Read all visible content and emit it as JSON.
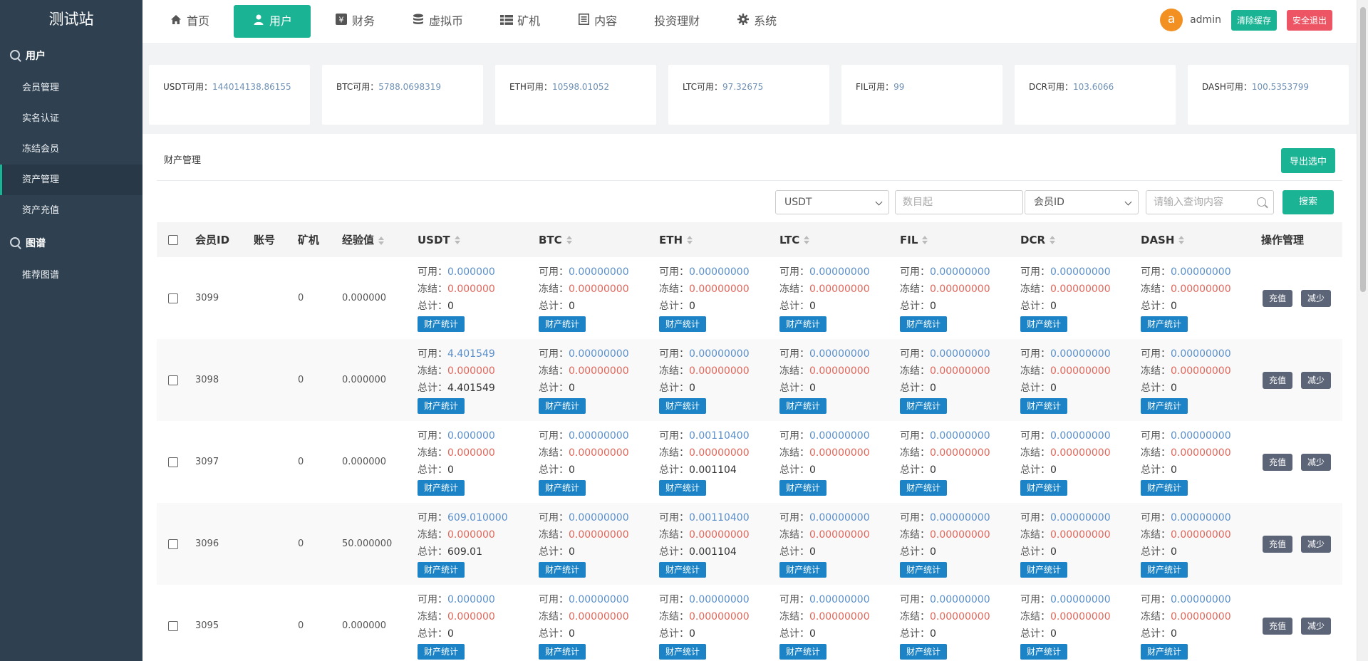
{
  "site": {
    "brand": "测试站"
  },
  "sidebar": {
    "groups": [
      {
        "label": "用户",
        "items": [
          "会员管理",
          "实名认证",
          "冻结会员",
          "资产管理",
          "资产充值"
        ]
      },
      {
        "label": "图谱",
        "items": [
          "推荐图谱"
        ]
      }
    ],
    "active_item": "资产管理"
  },
  "nav": {
    "items": [
      {
        "label": "首页",
        "icon": "home-icon"
      },
      {
        "label": "用户",
        "icon": "user-icon"
      },
      {
        "label": "财务",
        "icon": "yen-icon"
      },
      {
        "label": "虚拟币",
        "icon": "database-icon"
      },
      {
        "label": "矿机",
        "icon": "server-icon"
      },
      {
        "label": "内容",
        "icon": "document-icon"
      },
      {
        "label": "投资理财",
        "icon": ""
      },
      {
        "label": "系统",
        "icon": "gear-icon"
      }
    ],
    "active": "用户"
  },
  "user": {
    "avatar_letter": "a",
    "name": "admin",
    "clear_cache": "清除缓存",
    "logout": "安全退出"
  },
  "stats": [
    {
      "label": "USDT可用：",
      "value": "144014138.86155"
    },
    {
      "label": "BTC可用：",
      "value": "5788.0698319"
    },
    {
      "label": "ETH可用：",
      "value": "10598.01052"
    },
    {
      "label": "LTC可用：",
      "value": "97.32675"
    },
    {
      "label": "FIL可用：",
      "value": "99"
    },
    {
      "label": "DCR可用：",
      "value": "103.6066"
    },
    {
      "label": "DASH可用：",
      "value": "100.5353799"
    }
  ],
  "panel": {
    "title": "财产管理",
    "export_label": "导出选中",
    "filters": {
      "coin_select": "USDT",
      "amount_placeholder": "数目起",
      "field_select": "会员ID",
      "query_placeholder": "请输入查询内容",
      "search_label": "搜索"
    }
  },
  "table": {
    "headers": {
      "member_id": "会员ID",
      "account": "账号",
      "miner": "矿机",
      "exp": "经验值",
      "coins": [
        "USDT",
        "BTC",
        "ETH",
        "LTC",
        "FIL",
        "DCR",
        "DASH"
      ],
      "ops": "操作管理"
    },
    "labels": {
      "available": "可用：",
      "frozen": "冻结：",
      "total": "总计：",
      "stat_button": "财产统计",
      "recharge": "充值",
      "reduce": "减少"
    },
    "rows": [
      {
        "id": "3099",
        "account": "",
        "miner": "0",
        "exp": "0.000000",
        "coins": [
          {
            "avail": "0.000000",
            "frozen": "0.000000",
            "total": "0"
          },
          {
            "avail": "0.00000000",
            "frozen": "0.00000000",
            "total": "0"
          },
          {
            "avail": "0.00000000",
            "frozen": "0.00000000",
            "total": "0"
          },
          {
            "avail": "0.00000000",
            "frozen": "0.00000000",
            "total": "0"
          },
          {
            "avail": "0.00000000",
            "frozen": "0.00000000",
            "total": "0"
          },
          {
            "avail": "0.00000000",
            "frozen": "0.00000000",
            "total": "0"
          },
          {
            "avail": "0.00000000",
            "frozen": "0.00000000",
            "total": "0"
          }
        ]
      },
      {
        "id": "3098",
        "account": "",
        "miner": "0",
        "exp": "0.000000",
        "coins": [
          {
            "avail": "4.401549",
            "frozen": "0.000000",
            "total": "4.401549"
          },
          {
            "avail": "0.00000000",
            "frozen": "0.00000000",
            "total": "0"
          },
          {
            "avail": "0.00000000",
            "frozen": "0.00000000",
            "total": "0"
          },
          {
            "avail": "0.00000000",
            "frozen": "0.00000000",
            "total": "0"
          },
          {
            "avail": "0.00000000",
            "frozen": "0.00000000",
            "total": "0"
          },
          {
            "avail": "0.00000000",
            "frozen": "0.00000000",
            "total": "0"
          },
          {
            "avail": "0.00000000",
            "frozen": "0.00000000",
            "total": "0"
          }
        ]
      },
      {
        "id": "3097",
        "account": "",
        "miner": "0",
        "exp": "0.000000",
        "coins": [
          {
            "avail": "0.000000",
            "frozen": "0.000000",
            "total": "0"
          },
          {
            "avail": "0.00000000",
            "frozen": "0.00000000",
            "total": "0"
          },
          {
            "avail": "0.00110400",
            "frozen": "0.00000000",
            "total": "0.001104"
          },
          {
            "avail": "0.00000000",
            "frozen": "0.00000000",
            "total": "0"
          },
          {
            "avail": "0.00000000",
            "frozen": "0.00000000",
            "total": "0"
          },
          {
            "avail": "0.00000000",
            "frozen": "0.00000000",
            "total": "0"
          },
          {
            "avail": "0.00000000",
            "frozen": "0.00000000",
            "total": "0"
          }
        ]
      },
      {
        "id": "3096",
        "account": "",
        "miner": "0",
        "exp": "50.000000",
        "coins": [
          {
            "avail": "609.010000",
            "frozen": "0.000000",
            "total": "609.01"
          },
          {
            "avail": "0.00000000",
            "frozen": "0.00000000",
            "total": "0"
          },
          {
            "avail": "0.00110400",
            "frozen": "0.00000000",
            "total": "0.001104"
          },
          {
            "avail": "0.00000000",
            "frozen": "0.00000000",
            "total": "0"
          },
          {
            "avail": "0.00000000",
            "frozen": "0.00000000",
            "total": "0"
          },
          {
            "avail": "0.00000000",
            "frozen": "0.00000000",
            "total": "0"
          },
          {
            "avail": "0.00000000",
            "frozen": "0.00000000",
            "total": "0"
          }
        ]
      },
      {
        "id": "3095",
        "account": "",
        "miner": "0",
        "exp": "0.000000",
        "coins": [
          {
            "avail": "0.000000",
            "frozen": "0.000000",
            "total": "0"
          },
          {
            "avail": "0.00000000",
            "frozen": "0.00000000",
            "total": "0"
          },
          {
            "avail": "0.00000000",
            "frozen": "0.00000000",
            "total": "0"
          },
          {
            "avail": "0.00000000",
            "frozen": "0.00000000",
            "total": "0"
          },
          {
            "avail": "0.00000000",
            "frozen": "0.00000000",
            "total": "0"
          },
          {
            "avail": "0.00000000",
            "frozen": "0.00000000",
            "total": "0"
          },
          {
            "avail": "0.00000000",
            "frozen": "0.00000000",
            "total": "0"
          }
        ]
      }
    ]
  }
}
